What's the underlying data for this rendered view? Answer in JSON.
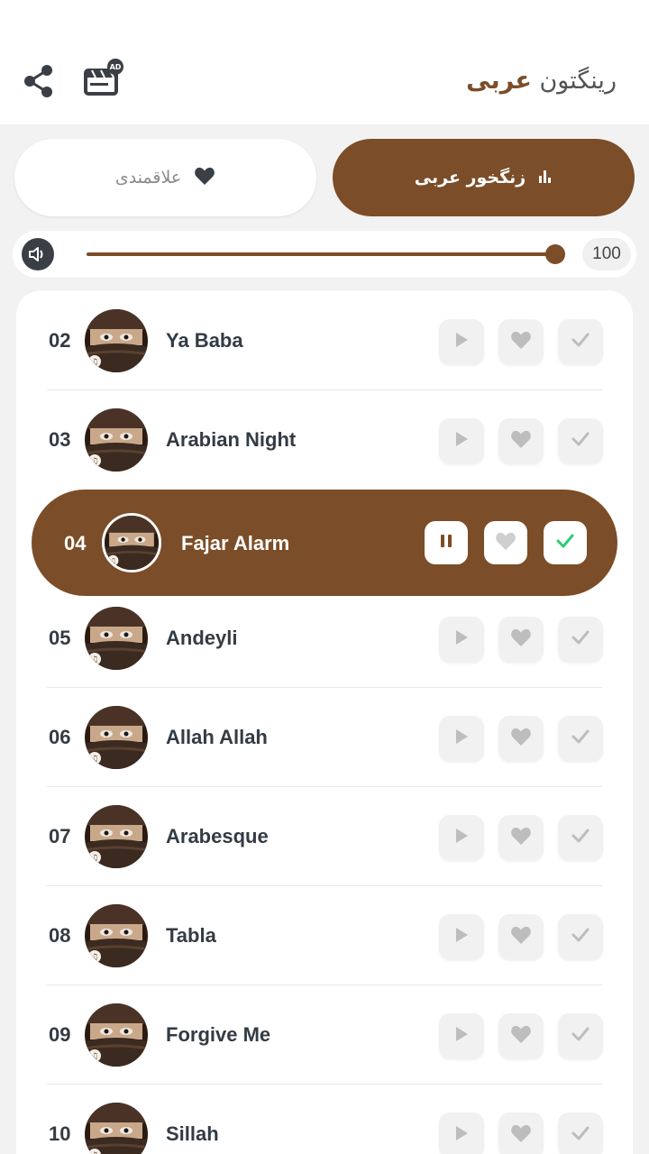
{
  "header": {
    "title_bold": "عربی",
    "title_normal": "رینگتون",
    "share_icon": "share-icon",
    "ad_icon": "ad-clapperboard-icon",
    "ad_badge": "AD"
  },
  "tabs": [
    {
      "label": "زنگخور عربی",
      "icon": "equalizer-icon",
      "active": true
    },
    {
      "label": "علاقمندی",
      "icon": "heart-icon",
      "active": false
    }
  ],
  "volume": {
    "value": "100",
    "level": 1.0,
    "icon": "speaker-icon"
  },
  "colors": {
    "accent": "#7b4d28",
    "check_active": "#2ecc71"
  },
  "songs": [
    {
      "num": "02",
      "name": "Ya Baba"
    },
    {
      "num": "03",
      "name": "Arabian Night"
    },
    {
      "num": "04",
      "name": "Fajar Alarm",
      "playing": true,
      "selected": true
    },
    {
      "num": "05",
      "name": "Andeyli"
    },
    {
      "num": "06",
      "name": "Allah Allah"
    },
    {
      "num": "07",
      "name": "Arabesque"
    },
    {
      "num": "08",
      "name": "Tabla"
    },
    {
      "num": "09",
      "name": "Forgive Me"
    },
    {
      "num": "10",
      "name": "Sillah"
    }
  ]
}
